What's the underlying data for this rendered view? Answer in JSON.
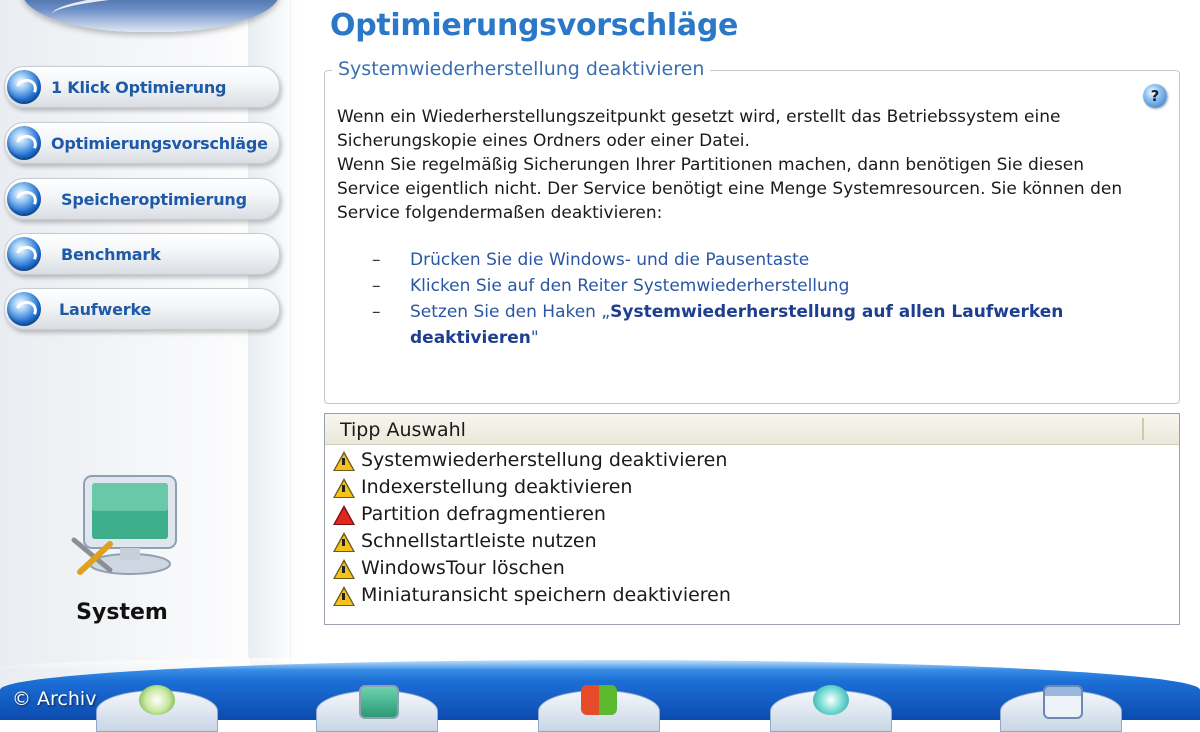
{
  "page": {
    "title": "Optimierungsvorschläge"
  },
  "sidebar": {
    "items": [
      {
        "label": "1 Klick Optimierung",
        "icon": "refresh-orb-icon"
      },
      {
        "label": "Optimierungsvorschläge",
        "icon": "refresh-orb-icon"
      },
      {
        "label": "Speicheroptimierung",
        "icon": "refresh-orb-icon"
      },
      {
        "label": "Benchmark",
        "icon": "refresh-orb-icon"
      },
      {
        "label": "Laufwerke",
        "icon": "refresh-orb-icon"
      }
    ],
    "section_label": "System",
    "section_icon": "monitor-tools-icon"
  },
  "panel": {
    "legend": "Systemwiederherstellung deaktivieren",
    "help_icon_glyph": "?",
    "description": [
      "Wenn ein Wiederherstellungszeitpunkt gesetzt wird, erstellt das Betriebssystem eine Sicherungskopie eines Ordners oder einer Datei.",
      "Wenn Sie regelmäßig Sicherungen Ihrer Partitionen machen, dann benötigen Sie diesen Service eigentlich nicht. Der Service benötigt eine Menge Systemresourcen. Sie können den Service folgendermaßen deaktivieren:"
    ],
    "steps": {
      "dash": "–",
      "step1": "Drücken Sie die Windows- und die Pausentaste",
      "step2": "Klicken Sie auf den Reiter Systemwiederherstellung",
      "step3_prefix": "Setzen Sie den Haken „",
      "step3_bold": "Systemwiederherstellung auf allen Laufwerken deaktivieren",
      "step3_suffix": "\""
    }
  },
  "tips": {
    "header": "Tipp Auswahl",
    "items": [
      {
        "label": "Systemwiederherstellung deaktivieren",
        "severity": "warning"
      },
      {
        "label": "Indexerstellung deaktivieren",
        "severity": "warning"
      },
      {
        "label": "Partition defragmentieren",
        "severity": "critical"
      },
      {
        "label": "Schnellstartleiste nutzen",
        "severity": "warning"
      },
      {
        "label": "WindowsTour löschen",
        "severity": "warning"
      },
      {
        "label": "Miniaturansicht speichern deaktivieren",
        "severity": "warning"
      }
    ]
  },
  "footer": {
    "copyright": "© Archiv"
  },
  "colors": {
    "title": "#2a78c7",
    "nav_text": "#1f5aa8",
    "link": "#2b56a3",
    "warning": "#f4c21b",
    "critical": "#e1261c",
    "bottom_bar": "#1c6fd6"
  }
}
